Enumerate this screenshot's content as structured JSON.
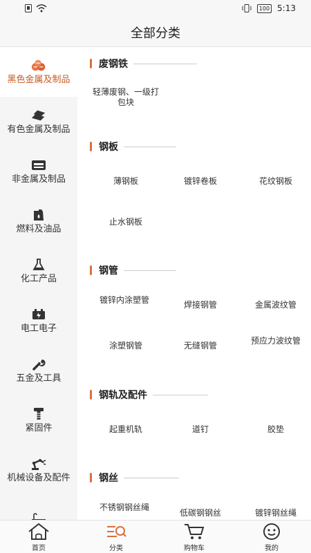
{
  "status_bar": {
    "time": "5:13",
    "battery": "100"
  },
  "header": {
    "title": "全部分类"
  },
  "sidebar": {
    "items": [
      {
        "label": "黑色金属及制品",
        "icon": "metal-ingot-icon",
        "active": true
      },
      {
        "label": "有色金属及制品",
        "icon": "metal-bars-icon"
      },
      {
        "label": "非金属及制品",
        "icon": "nonmetal-icon"
      },
      {
        "label": "燃料及油品",
        "icon": "fuel-can-icon"
      },
      {
        "label": "化工产品",
        "icon": "flask-icon"
      },
      {
        "label": "电工电子",
        "icon": "battery-icon"
      },
      {
        "label": "五金及工具",
        "icon": "wrench-icon"
      },
      {
        "label": "紧固件",
        "icon": "screw-icon"
      },
      {
        "label": "机械设备及配件",
        "icon": "robot-arm-icon"
      }
    ]
  },
  "sections": [
    {
      "title": "废钢铁",
      "items": [
        "轻薄废钢、一级打包块"
      ]
    },
    {
      "title": "钢板",
      "items": [
        "薄钢板",
        "镀锌卷板",
        "花纹钢板",
        "止水钢板"
      ]
    },
    {
      "title": "钢管",
      "items": [
        "镀锌内涂塑管",
        "焊接钢管",
        "金属波纹管",
        "涂塑钢管",
        "无缝钢管",
        "预应力波纹管"
      ]
    },
    {
      "title": "钢轨及配件",
      "items": [
        "起重机轨",
        "道钉",
        "胶垫"
      ]
    },
    {
      "title": "钢丝",
      "items": [
        "不锈钢钢丝绳",
        "低碳钢钢丝",
        "镀锌钢丝绳"
      ]
    }
  ],
  "tabbar": {
    "items": [
      {
        "label": "首页",
        "icon": "home-icon"
      },
      {
        "label": "分类",
        "icon": "category-search-icon",
        "active": true
      },
      {
        "label": "购物车",
        "icon": "cart-icon"
      },
      {
        "label": "我的",
        "icon": "smiley-icon"
      }
    ]
  },
  "colors": {
    "accent": "#d9703d",
    "active_text": "#c85a25",
    "sidebar_bg": "#f5f5f5"
  }
}
